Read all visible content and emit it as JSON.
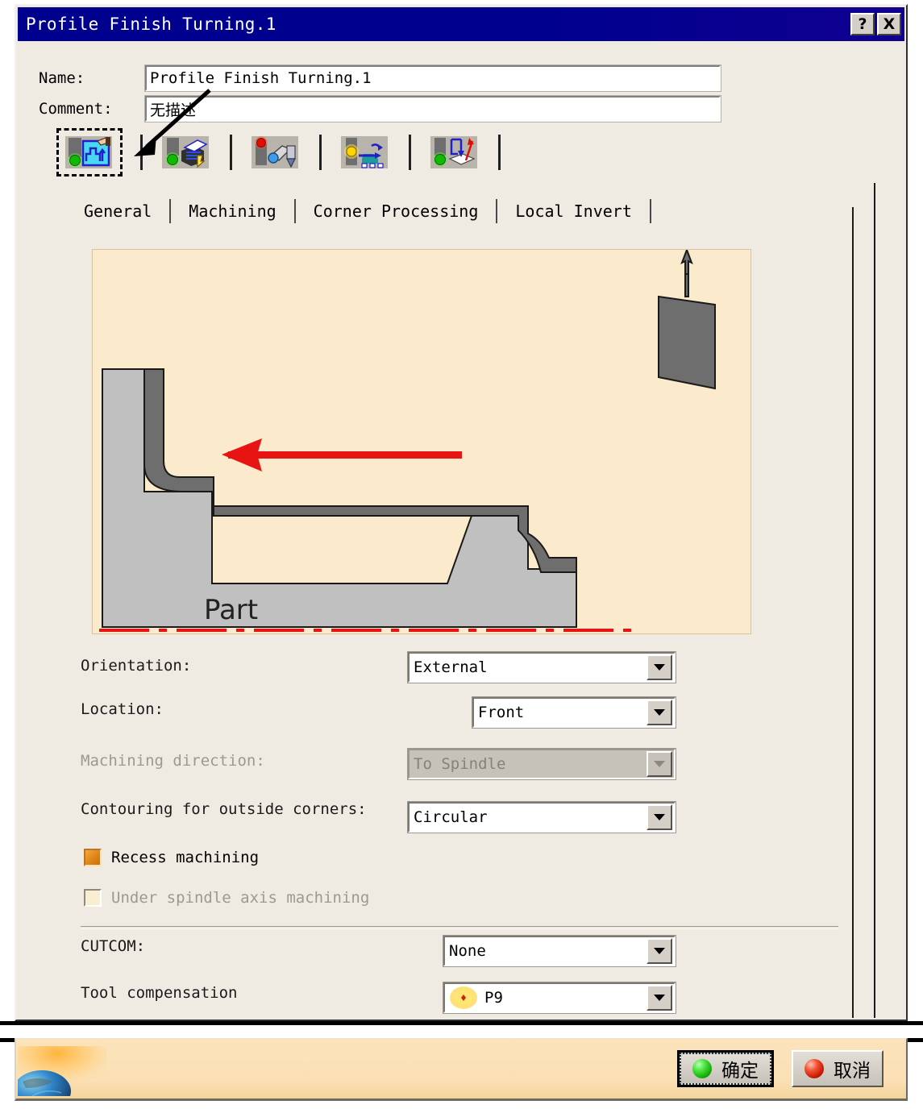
{
  "window": {
    "title": "Profile Finish Turning.1",
    "help_button": "?",
    "close_button": "X"
  },
  "fields": {
    "name_label": "Name:",
    "name_value": "Profile Finish Turning.1",
    "comment_label": "Comment:",
    "comment_value": "无描述"
  },
  "toolbar": {
    "items": [
      {
        "name": "geometry-icon",
        "tooltip": "Geometry"
      },
      {
        "name": "strategy-icon",
        "tooltip": "Strategy"
      },
      {
        "name": "tool-icon",
        "tooltip": "Tool"
      },
      {
        "name": "feeds-speeds-icon",
        "tooltip": "Feeds and Speeds"
      },
      {
        "name": "macros-icon",
        "tooltip": "Macros"
      }
    ]
  },
  "tabs": [
    {
      "label": "General",
      "active": true
    },
    {
      "label": "Machining",
      "active": false
    },
    {
      "label": "Corner Processing",
      "active": false
    },
    {
      "label": "Local Invert",
      "active": false
    }
  ],
  "preview": {
    "part_label": "Part",
    "background_color": "#fbeacb",
    "part_fill_color": "#c0c0c0",
    "machining_band_color": "#6e6e6e",
    "axis_color": "#e81414",
    "direction_arrow_color": "#e81414"
  },
  "form": {
    "orientation": {
      "label": "Orientation:",
      "value": "External",
      "disabled": false
    },
    "location": {
      "label": "Location:",
      "value": "Front",
      "disabled": false
    },
    "machining_direction": {
      "label": "Machining direction:",
      "value": "To Spindle",
      "disabled": true
    },
    "contouring_outside_corners": {
      "label": "Contouring for outside corners:",
      "value": "Circular",
      "disabled": false
    },
    "recess_machining": {
      "label": "Recess machining",
      "checked": true,
      "disabled": false
    },
    "under_spindle_axis_machining": {
      "label": "Under spindle axis machining",
      "checked": false,
      "disabled": true
    },
    "cutcom": {
      "label": "CUTCOM:",
      "value": "None",
      "disabled": false
    },
    "tool_compensation": {
      "label": "Tool compensation",
      "value": "P9",
      "disabled": false
    }
  },
  "footer": {
    "ok_label": "确定",
    "cancel_label": "取消"
  },
  "colors": {
    "titlebar": "#00008f",
    "dialog_background": "#efebe3",
    "preview_background": "#fbeacb",
    "checkbox_checked": "#e08416",
    "accent_red": "#e81414",
    "accent_green": "#11a806"
  }
}
